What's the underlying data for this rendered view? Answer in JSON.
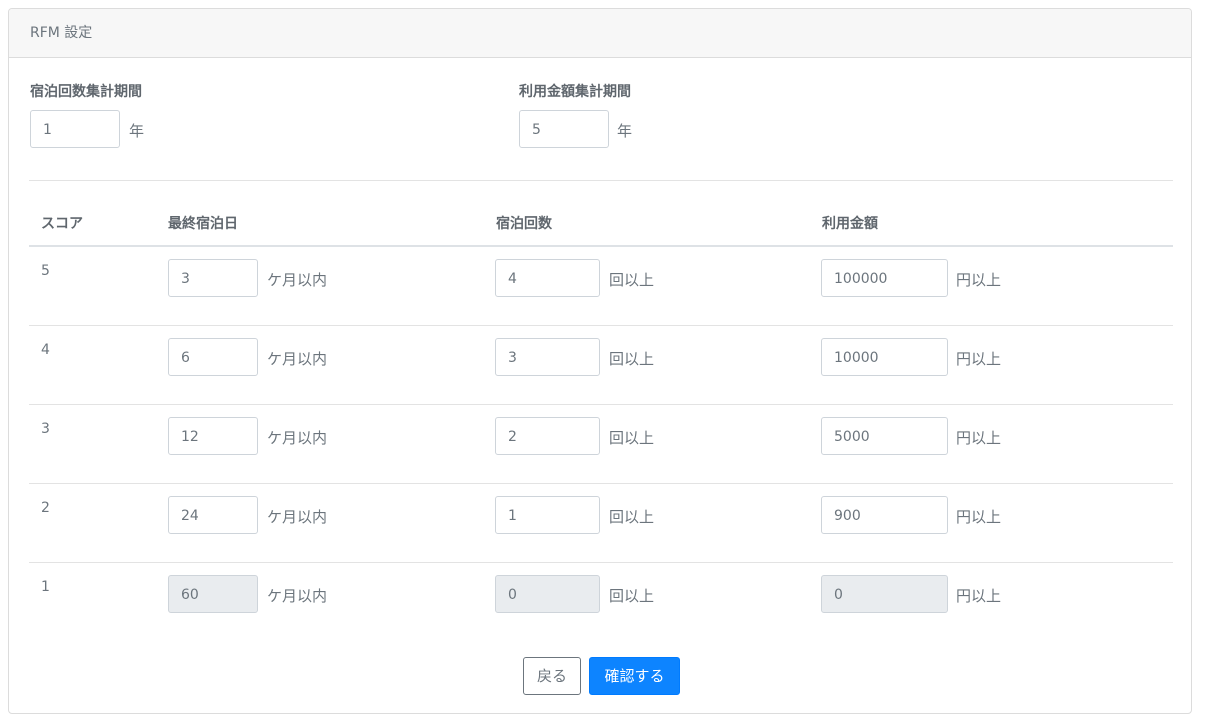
{
  "header": {
    "title": "RFM 設定"
  },
  "periods": {
    "stay": {
      "label": "宿泊回数集計期間",
      "value": "1",
      "unit": "年"
    },
    "amount": {
      "label": "利用金額集計期間",
      "value": "5",
      "unit": "年"
    }
  },
  "table": {
    "headers": [
      "スコア",
      "最終宿泊日",
      "宿泊回数",
      "利用金額"
    ],
    "units": {
      "recency": "ケ月以内",
      "frequency": "回以上",
      "monetary": "円以上"
    },
    "rows": [
      {
        "score": "5",
        "recency": "3",
        "frequency": "4",
        "monetary": "100000",
        "disabled": false
      },
      {
        "score": "4",
        "recency": "6",
        "frequency": "3",
        "monetary": "10000",
        "disabled": false
      },
      {
        "score": "3",
        "recency": "12",
        "frequency": "2",
        "monetary": "5000",
        "disabled": false
      },
      {
        "score": "2",
        "recency": "24",
        "frequency": "1",
        "monetary": "900",
        "disabled": false
      },
      {
        "score": "1",
        "recency": "60",
        "frequency": "0",
        "monetary": "0",
        "disabled": true
      }
    ]
  },
  "buttons": {
    "back": "戻る",
    "confirm": "確認する"
  },
  "colors": {
    "primary": "#0d84ff",
    "disabled_input": "#e9ecef",
    "header_bg": "#f7f7f7"
  }
}
